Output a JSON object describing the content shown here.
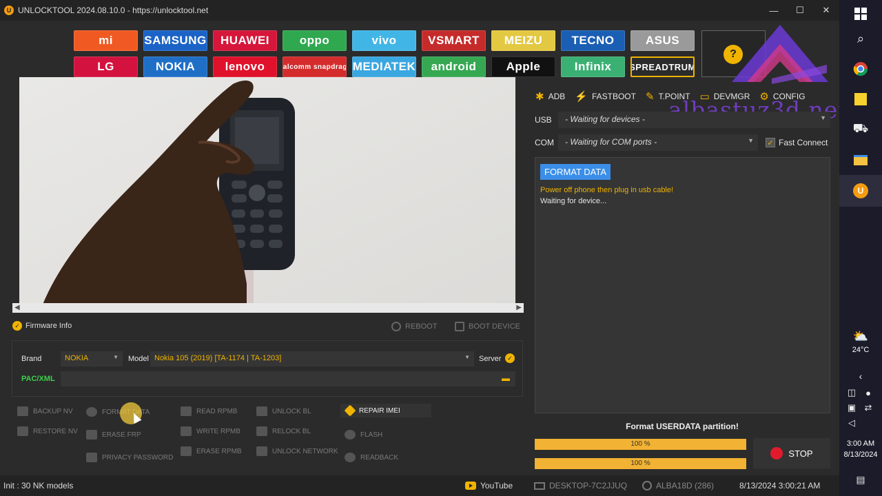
{
  "window": {
    "title": "UNLOCKTOOL 2024.08.10.0 - https://unlocktool.net"
  },
  "brands": [
    {
      "label": "mi",
      "bg": "#f05a22"
    },
    {
      "label": "SAMSUNG",
      "bg": "#1b63c6"
    },
    {
      "label": "HUAWEI",
      "bg": "#d6163a"
    },
    {
      "label": "oppo",
      "bg": "#2fa84f"
    },
    {
      "label": "vivo",
      "bg": "#41b6e6"
    },
    {
      "label": "VSMART",
      "bg": "#c62b2b"
    },
    {
      "label": "MEIZU",
      "bg": "#e3c842"
    },
    {
      "label": "TECNO",
      "bg": "#1a5fb4"
    },
    {
      "label": "ASUS",
      "bg": "#9a9a9a"
    },
    {
      "label": "LG",
      "bg": "#d3123f"
    },
    {
      "label": "NOKIA",
      "bg": "#1f6fc7"
    },
    {
      "label": "lenovo",
      "bg": "#e0112b"
    },
    {
      "label": "Qualcomm snapdragon",
      "bg": "#d42c2c"
    },
    {
      "label": "MEDIATEK",
      "bg": "#3aa7e0"
    },
    {
      "label": "android",
      "bg": "#36a852"
    },
    {
      "label": "Apple",
      "bg": "#111111"
    },
    {
      "label": "Infinix",
      "bg": "#3bb073"
    },
    {
      "label": "SPREADTRUM",
      "bg": "#2b2b2b"
    }
  ],
  "connection": {
    "tabs": [
      "ADB",
      "FASTBOOT",
      "T.POINT",
      "DEVMGR",
      "CONFIG"
    ],
    "usb_label": "USB",
    "usb_value": "- Waiting for devices -",
    "com_label": "COM",
    "com_value": "- Waiting for COM ports -",
    "fast_connect": "Fast Connect"
  },
  "watermark": "albastuz3d.net",
  "log": {
    "badge": "FORMAT DATA",
    "line1": "Power off phone then plug in usb cable!",
    "line2": "Waiting for device..."
  },
  "progress": {
    "status": "Format USERDATA partition!",
    "bar1_pct": 100,
    "bar1_text": "100 %",
    "bar2_pct": 100,
    "bar2_text": "100 %",
    "stop_label": "STOP"
  },
  "firmware": {
    "info_label": "Firmware Info",
    "reboot_label": "REBOOT",
    "boot_device_label": "BOOT DEVICE",
    "brand_label": "Brand",
    "brand_value": "NOKIA",
    "model_label": "Model",
    "model_value": "Nokia 105 (2019) [TA-1174 | TA-1203]",
    "server_label": "Server",
    "pac_label": "PAC/XML"
  },
  "actions": {
    "backup_nv": "BACKUP NV",
    "restore_nv": "RESTORE NV",
    "format_data": "FORMAT DATA",
    "erase_frp": "ERASE FRP",
    "privacy_password": "PRIVACY PASSWORD",
    "read_rpmb": "READ RPMB",
    "write_rpmb": "WRITE RPMB",
    "erase_rpmb": "ERASE RPMB",
    "unlock_bl": "UNLOCK BL",
    "relock_bl": "RELOCK BL",
    "unlock_network": "UNLOCK NETWORK",
    "repair_imei": "REPAIR IMEI",
    "flash": "FLASH",
    "readback": "READBACK"
  },
  "statusbar": {
    "init": "Init : 30 NK models",
    "youtube": "YouTube",
    "desktop": "DESKTOP-7C2JJUQ",
    "user": "ALBA18D (286)",
    "datetime": "8/13/2024 3:00:21 AM"
  },
  "taskbar": {
    "temp": "24°C",
    "time": "3:00 AM",
    "date": "8/13/2024"
  },
  "colors": {
    "accent": "#f0b400",
    "log_badge": "#3b8ee8",
    "stop": "#e11b2c"
  }
}
